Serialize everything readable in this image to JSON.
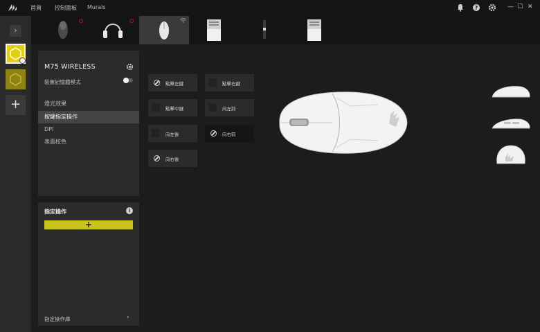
{
  "titlebar": {
    "nav": [
      "首頁",
      "控制面板",
      "Murals"
    ],
    "icons": [
      "bell-icon",
      "help-icon",
      "settings-icon"
    ],
    "window_controls": [
      "—",
      "☐",
      "✕"
    ]
  },
  "rail": {
    "toggle_glyph": "›",
    "add_glyph": "+"
  },
  "devices": [
    {
      "icon": "mouse-icon",
      "power": "⏻"
    },
    {
      "icon": "headset-icon",
      "power": "⏻"
    },
    {
      "icon": "wireless-mouse-icon",
      "wifi": "wifi-icon"
    },
    {
      "icon": "usb-receiver-icon"
    },
    {
      "icon": "usb-dongle-icon"
    },
    {
      "icon": "usb-receiver-icon"
    }
  ],
  "device_panel": {
    "name": "M75 WIRELESS",
    "memory_mode_label": "裝置記憶體模式",
    "menu": [
      "燈光效果",
      "按鍵指定操作",
      "DPI",
      "表面校色"
    ],
    "active_menu": "按鍵指定操作"
  },
  "actions_panel": {
    "title": "指定操作",
    "add_glyph": "+",
    "library_label": "指定操作庫",
    "library_chevron": "›"
  },
  "button_assignments": [
    {
      "label": "點擊左鍵",
      "icon": "disabled-icon"
    },
    {
      "label": "點擊右鍵",
      "icon": "square-icon"
    },
    {
      "label": "點擊中鍵",
      "icon": "square-icon"
    },
    {
      "label": "向左前",
      "icon": "square-icon"
    },
    {
      "label": "向左後",
      "icon": "square-icon"
    },
    {
      "label": "向右前",
      "icon": "disabled-icon"
    },
    {
      "label": "向右後",
      "icon": "disabled-icon"
    }
  ],
  "colors": {
    "accent_yellow": "#e3cf10",
    "add_button": "#c9c51d",
    "power_red": "#d62828"
  }
}
